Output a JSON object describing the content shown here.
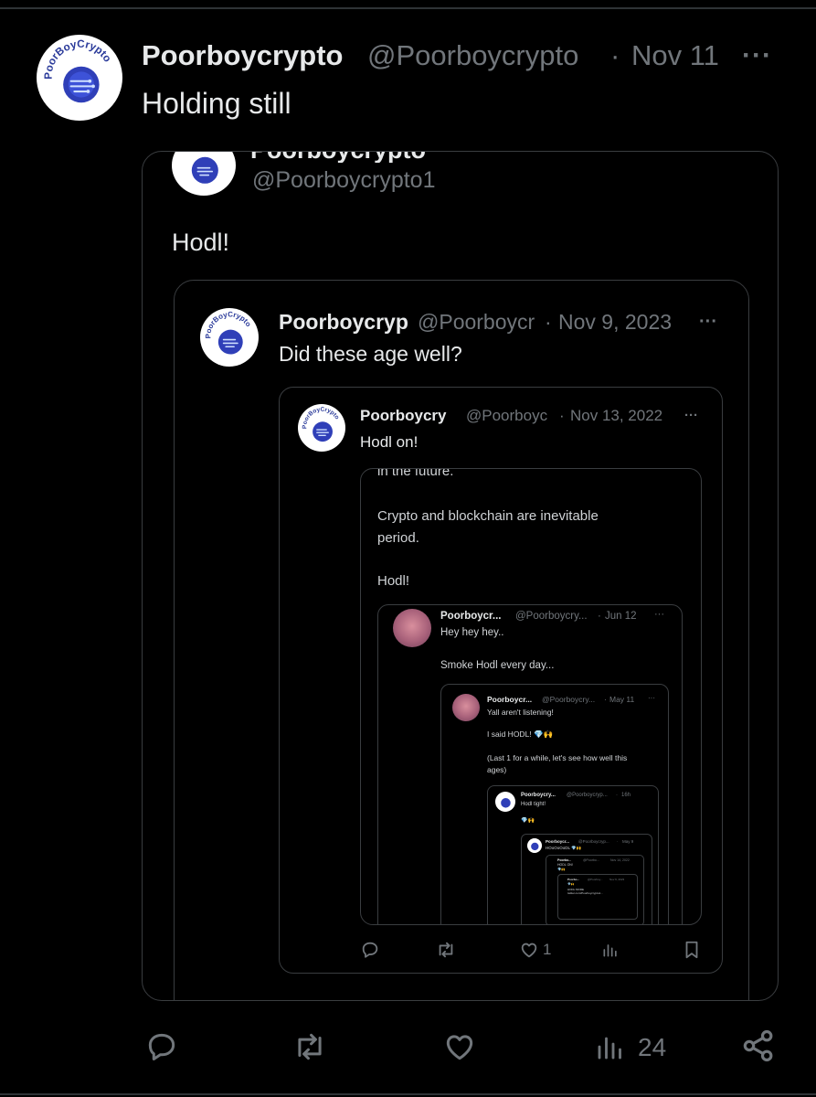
{
  "tweet": {
    "display_name": "Poorboycrypto",
    "handle": "@Poorboycrypto",
    "separator": "·",
    "date": "Nov 11",
    "more": "···",
    "text": "Holding still",
    "logo_text": "PoorBoyCrypto",
    "actions": {
      "views_count": "24"
    }
  },
  "quote1": {
    "name_cut": "Poorboycrypto",
    "handle": "@Poorboycrypto1",
    "text": "Hodl!"
  },
  "quote2": {
    "display_name": "Poorboycryp",
    "handle": "@Poorboycr",
    "separator": "·",
    "date": "Nov 9, 2023",
    "more": "···",
    "text": "Did these age well?"
  },
  "quote3": {
    "display_name": "Poorboycry",
    "handle": "@Poorboyc",
    "separator": "·",
    "date": "Nov 13, 2022",
    "more": "···",
    "text": "Hodl on!",
    "likes": "1"
  },
  "quote4": {
    "line_cut": "in the future.",
    "line2": "Crypto and blockchain are inevitable",
    "line3": "period.",
    "line4": "Hodl!"
  },
  "quote5": {
    "display_name": "Poorboycr...",
    "handle": "@Poorboycry...",
    "separator": "·",
    "date": "Jun 12",
    "more": "···",
    "line1": "Hey hey hey..",
    "line2": "Smoke Hodl every day..."
  },
  "quote6": {
    "display_name": "Poorboycr...",
    "handle": "@Poorboycry...",
    "separator": "·",
    "date": "May 11",
    "more": "···",
    "line1": "Yall aren't listening!",
    "line2": "I said HODL! 💎🙌",
    "line3": "(Last 1 for a while, let's see how well this",
    "line4": "ages)"
  },
  "quote7": {
    "display_name": "Poorboycry...",
    "handle": "@Poorboycryp...",
    "separator": "·",
    "date": "16h",
    "line1": "Hodl tight!",
    "line2": "💎🙌"
  },
  "quote8": {
    "display_name": "Poorboycr...",
    "handle": "@Poorboycryp...",
    "separator": "·",
    "date": "May 9",
    "line1": "HOoOoOoDL 💎🙌"
  },
  "quote9": {
    "display_name": "Poorbo...",
    "handle": "@Poorbo...",
    "date": "Nov 14, 2022",
    "line1": "HODL ON!",
    "line2": "💎🙌"
  },
  "quote10": {
    "display_name": "Poorbo...",
    "handle": "@Poorboy...",
    "date": "Nov 9, 2023",
    "line1": "💎🙌",
    "line2": "HODL MORE",
    "line3": "twitter.com/Poorboycrypto1..."
  }
}
